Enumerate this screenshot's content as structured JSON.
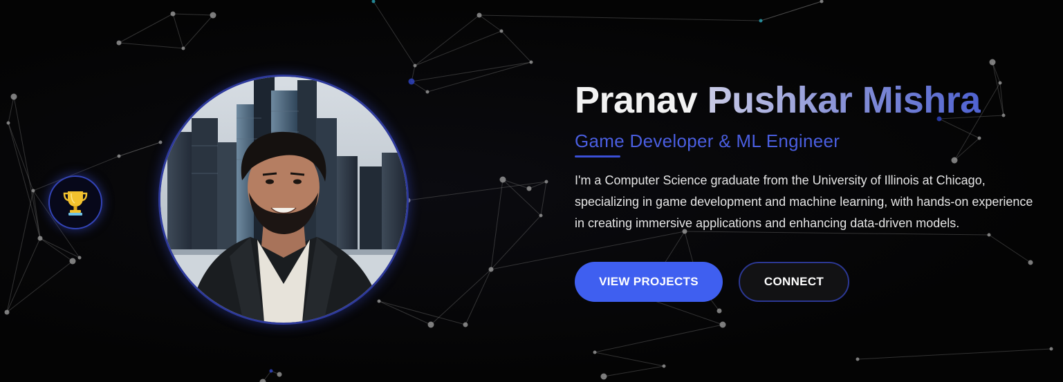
{
  "hero": {
    "first_name": "Pranav",
    "last_name": "Pushkar Mishra",
    "role": "Game Developer & ML Engineer",
    "bio": "I'm a Computer Science graduate from the University of Illinois at Chicago, specializing in game development and machine learning, with hands-on experience in creating immersive applications and enhancing data-driven models.",
    "primary_button": "VIEW PROJECTS",
    "secondary_button": "CONNECT",
    "badge_icon": "trophy-icon",
    "profile_photo": "profile-photo"
  },
  "colors": {
    "accent": "#3f5ff0",
    "role_text": "#4a5ee0",
    "background": "#050505",
    "trophy": "#f2c12e"
  }
}
